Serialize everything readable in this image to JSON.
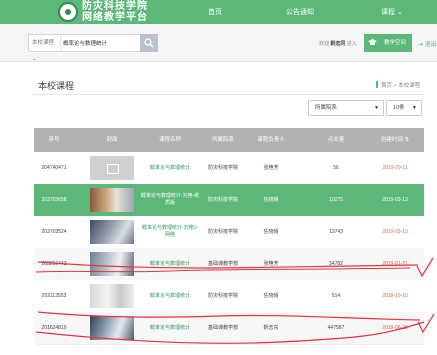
{
  "header": {
    "brand_line1": "防灾科技学院",
    "brand_line2": "网络教学平台",
    "nav_home": "首页",
    "nav_notice": "公告通知",
    "nav_course": "课程 ⌄"
  },
  "search": {
    "scope": "本校课程 ⌄",
    "query": "概率论与数理统计"
  },
  "user": {
    "welcome_prefix": "欢迎",
    "name": "靳志同",
    "role": "进入",
    "teach_space": "教学空间",
    "logout": "退出"
  },
  "page": {
    "title": "本校课程",
    "crumbs": "首页 > 本校课程"
  },
  "filters": {
    "department": "所属院系",
    "page_size": "10条"
  },
  "table": {
    "columns": [
      "序号",
      "封面",
      "课程名称",
      "所属院系",
      "课程负责人",
      "点击量",
      "创建时间 ⇅"
    ],
    "rows": [
      {
        "id": "204740471",
        "course": "概率论与数理统计",
        "dept": "防灾科技学院",
        "owner": "张艳芳",
        "clicks": "56",
        "created": "2019-09-11"
      },
      {
        "id": "203703658",
        "course": "概率论与数理统计-刘艳-纸质版",
        "dept": "防灾科技学院",
        "owner": "任晓晴",
        "clicks": "10275",
        "created": "2019-03-13"
      },
      {
        "id": "203703524",
        "course": "概率论与数理统计-刘艳1-网络",
        "dept": "防灾科技学院",
        "owner": "任晓晴",
        "clicks": "13743",
        "created": "2019-03-13"
      },
      {
        "id": "203256442",
        "course": "概率论与数理统计",
        "dept": "基础课教学部",
        "owner": "张艳芳",
        "clicks": "34782",
        "created": "2019-01-21"
      },
      {
        "id": "202113553",
        "course": "概率论与数理统计",
        "dept": "防灾科技学院",
        "owner": "任晓晴",
        "clicks": "514",
        "created": "2018-10-10"
      },
      {
        "id": "201624810",
        "course": "概率论与数理统计",
        "dept": "基础课教学部",
        "owner": "靳志东",
        "clicks": "447587",
        "created": "2018-06-28"
      }
    ]
  },
  "colors": {
    "primary_green": "#5bb878",
    "date_red": "#e0604a",
    "annotation_red": "#e8323c"
  }
}
